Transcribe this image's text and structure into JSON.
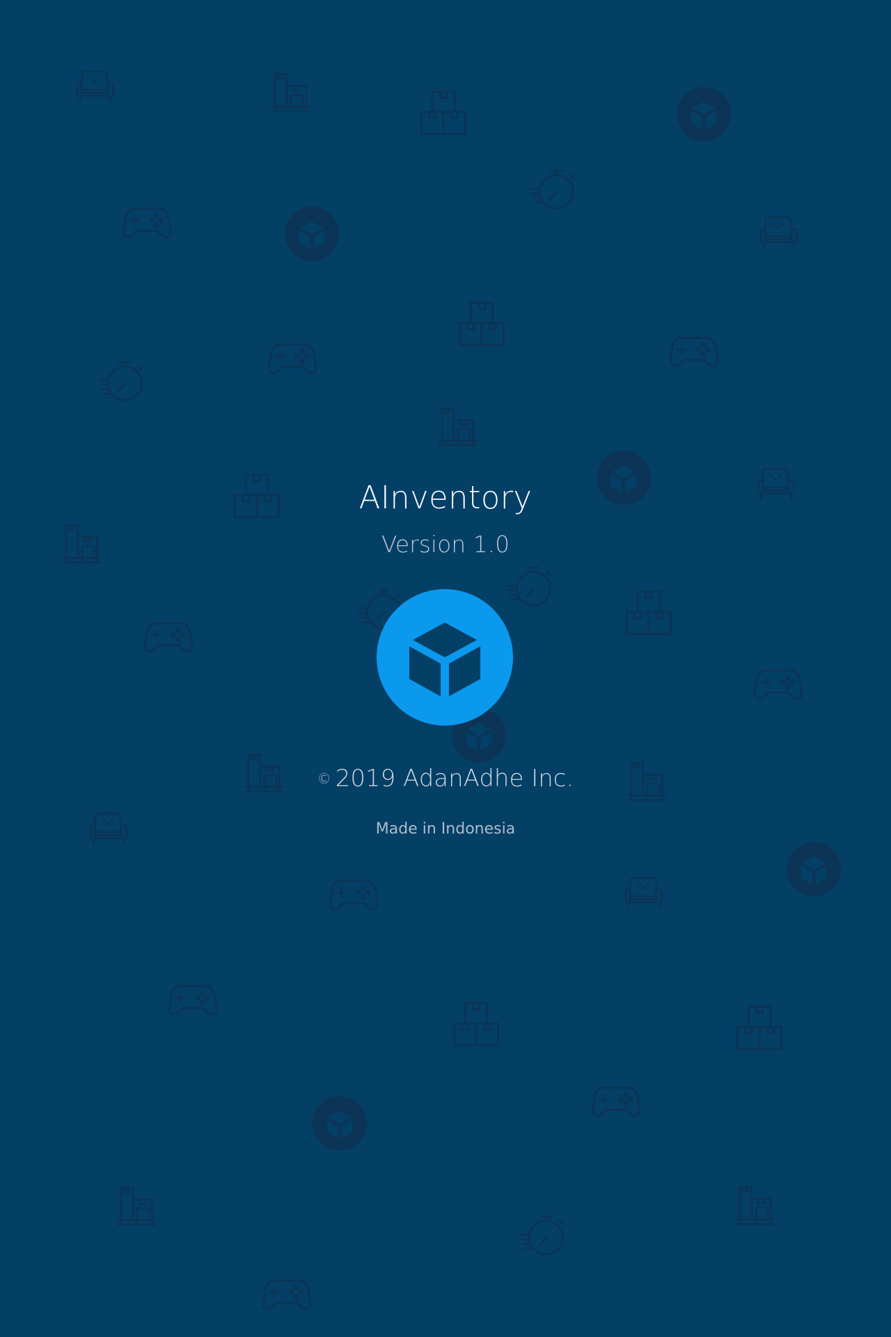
{
  "app": {
    "title": "AInventory",
    "version": "Version 1.0",
    "copyright_symbol": "©",
    "copyright": "2019 AdanAdhe Inc.",
    "made_in": "Made in Indonesia"
  },
  "logo": {
    "icon": "cube-icon",
    "color": "#0b99ee"
  },
  "background": {
    "color": "#043f66",
    "pattern_color": "#0b3456",
    "pattern_icons": [
      "armchair-icon",
      "boxes-pallet-icon",
      "boxes-stack-icon",
      "cube-circle-icon",
      "gamepad-icon",
      "stopwatch-icon"
    ]
  }
}
